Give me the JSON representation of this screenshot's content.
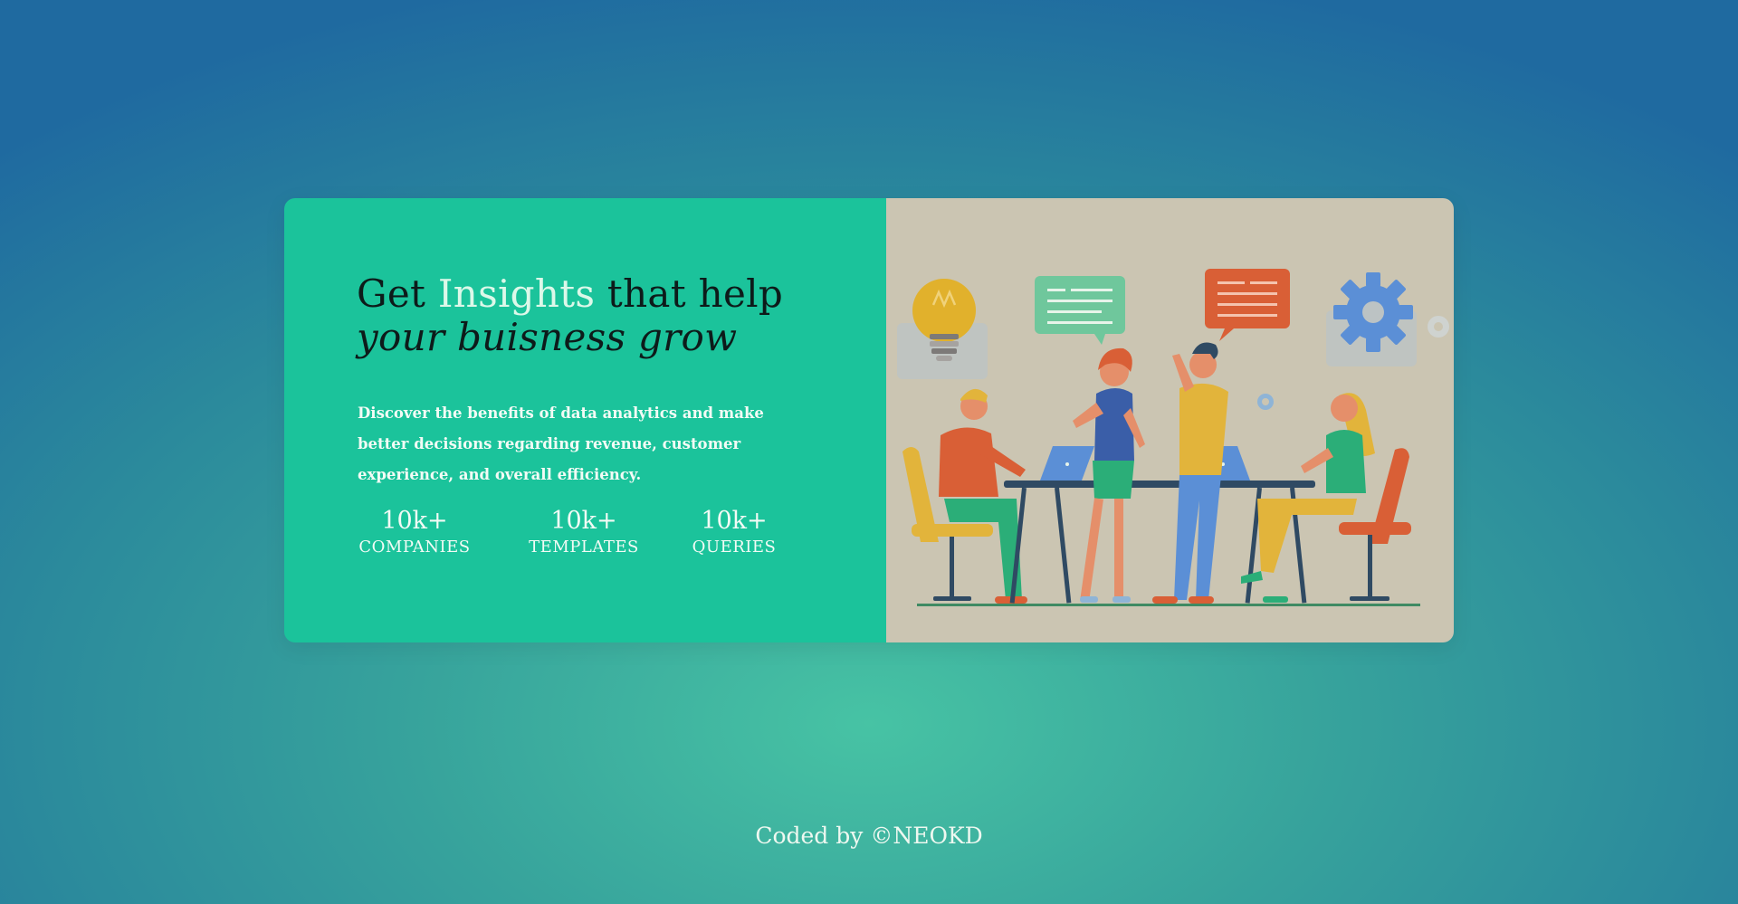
{
  "hero": {
    "headline_prefix": "Get",
    "headline_accent": "Insights",
    "headline_suffix": "that help",
    "headline_line2": "your buisness grow",
    "description": "Discover the benefits of data analytics and make better decisions regarding revenue, customer experience, and overall efficiency."
  },
  "stats": [
    {
      "value": "10k+",
      "label": "COMPANIES"
    },
    {
      "value": "10k+",
      "label": "TEMPLATES"
    },
    {
      "value": "10k+",
      "label": "QUERIES"
    }
  ],
  "footer": {
    "text": "Coded by ©NEOKD"
  },
  "colors": {
    "card_left": "#1bc39b",
    "card_right": "#cbc5b2",
    "accent_text": "#dcf8e9"
  },
  "illustration": {
    "icons": [
      "lightbulb-icon",
      "chat-bubble-icon",
      "gear-icon"
    ]
  }
}
